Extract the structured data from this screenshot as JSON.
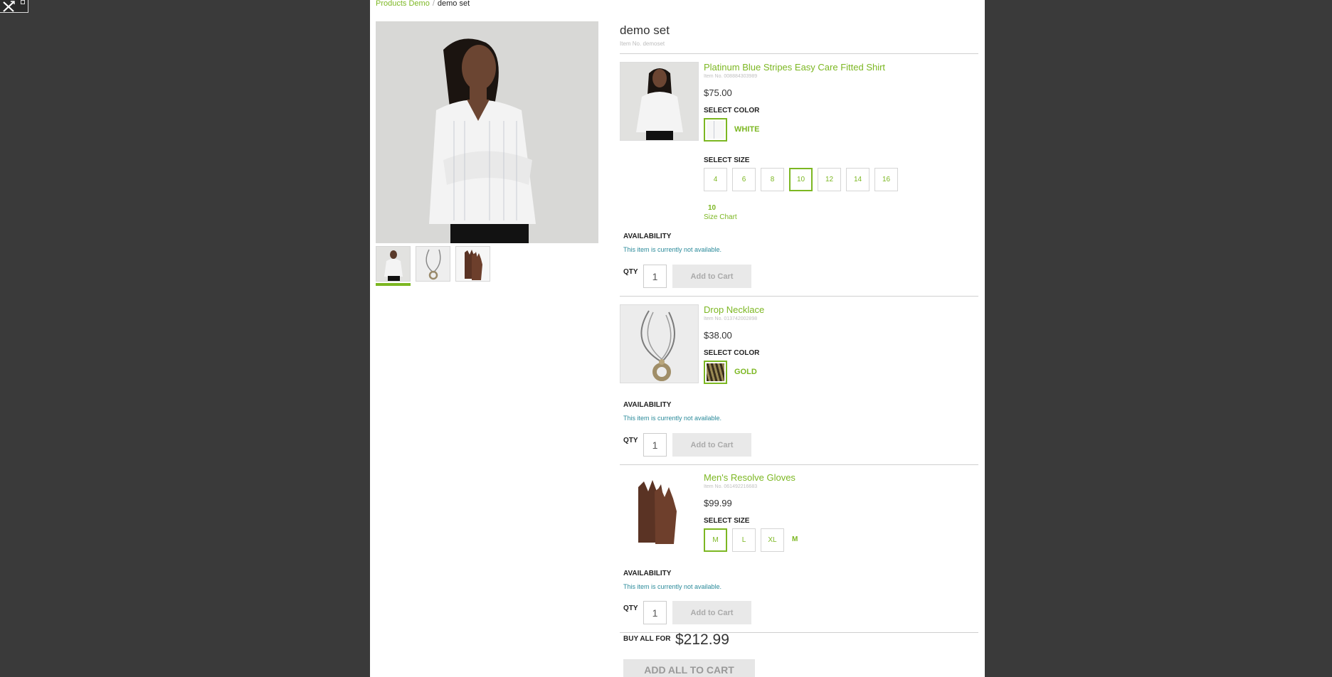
{
  "breadcrumb": {
    "parent": "Products Demo",
    "separator": "/",
    "current": "demo set"
  },
  "set": {
    "title": "demo set",
    "item_no": "Item No. demoset"
  },
  "thumbnails": [
    {
      "name": "shirt-thumbnail",
      "active": true
    },
    {
      "name": "necklace-thumbnail",
      "active": false
    },
    {
      "name": "gloves-thumbnail",
      "active": false
    }
  ],
  "labels": {
    "select_color": "SELECT COLOR",
    "select_size": "SELECT SIZE",
    "availability": "AVAILABILITY",
    "qty": "QTY",
    "add_to_cart": "Add to Cart",
    "size_chart": "Size Chart",
    "not_available": "This item is currently not available.",
    "buy_all_for": "BUY ALL FOR",
    "add_all": "ADD ALL TO CART"
  },
  "products": [
    {
      "name": "Platinum Blue Stripes Easy Care Fitted Shirt",
      "item_no": "Item No. 008884303989",
      "price": "$75.00",
      "color": "WHITE",
      "sizes": [
        "4",
        "6",
        "8",
        "10",
        "12",
        "14",
        "16"
      ],
      "selected_size": "10",
      "qty": "1"
    },
    {
      "name": "Drop Necklace",
      "item_no": "Item No. 013742002898",
      "price": "$38.00",
      "color": "GOLD",
      "qty": "1"
    },
    {
      "name": "Men's Resolve Gloves",
      "item_no": "Item No. 061492216683",
      "price": "$99.99",
      "sizes": [
        "M",
        "L",
        "XL"
      ],
      "selected_size": "M",
      "qty": "1"
    }
  ],
  "buy_all_price": "$212.99",
  "colors": {
    "accent": "#7cb722",
    "availability": "#2a8a9a",
    "backdrop": "#3a3a3a"
  }
}
